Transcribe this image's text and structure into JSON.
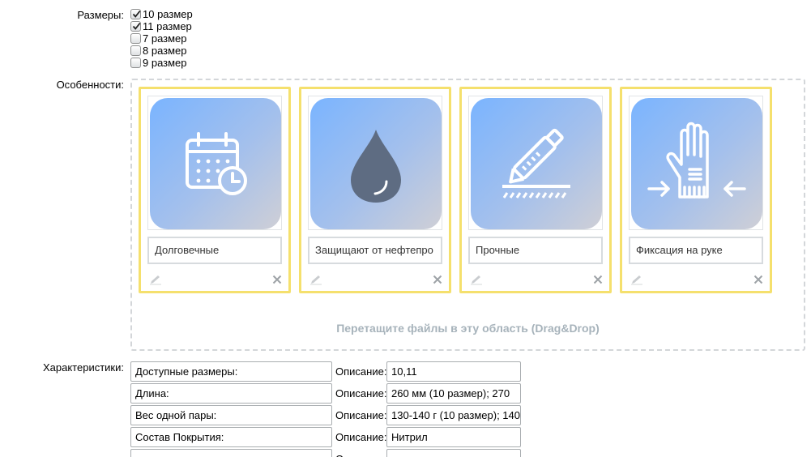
{
  "sizes": {
    "label": "Размеры:",
    "options": [
      {
        "label": "10 размер",
        "checked": true
      },
      {
        "label": "11 размер",
        "checked": true
      },
      {
        "label": "7 размер",
        "checked": false
      },
      {
        "label": "8 размер",
        "checked": false
      },
      {
        "label": "9 размер",
        "checked": false
      }
    ]
  },
  "features": {
    "label": "Особенности:",
    "drop_hint": "Перетащите файлы в эту область (Drag&Drop)",
    "cards": [
      {
        "caption": "Долговечные",
        "icon": "calendar-clock-icon"
      },
      {
        "caption": "Защищают от нефтепро",
        "icon": "oil-drop-icon"
      },
      {
        "caption": "Прочные",
        "icon": "utility-knife-icon"
      },
      {
        "caption": "Фиксация на руке",
        "icon": "glove-fixation-icon"
      }
    ],
    "tile_gradient": [
      "#7ab4ff",
      "#cfcfd6"
    ],
    "card_border_color": "#f5e06d"
  },
  "characteristics": {
    "label": "Характеристики:",
    "desc_label": "Описание:",
    "rows": [
      {
        "name": "Доступные размеры:",
        "value": "10,11"
      },
      {
        "name": "Длина:",
        "value": "260 мм (10 размер);  270"
      },
      {
        "name": "Вес одной пары:",
        "value": "130-140 г (10 размер); 140"
      },
      {
        "name": "Состав Покрытия:",
        "value": "Нитрил"
      },
      {
        "name": "",
        "value": ""
      }
    ]
  }
}
